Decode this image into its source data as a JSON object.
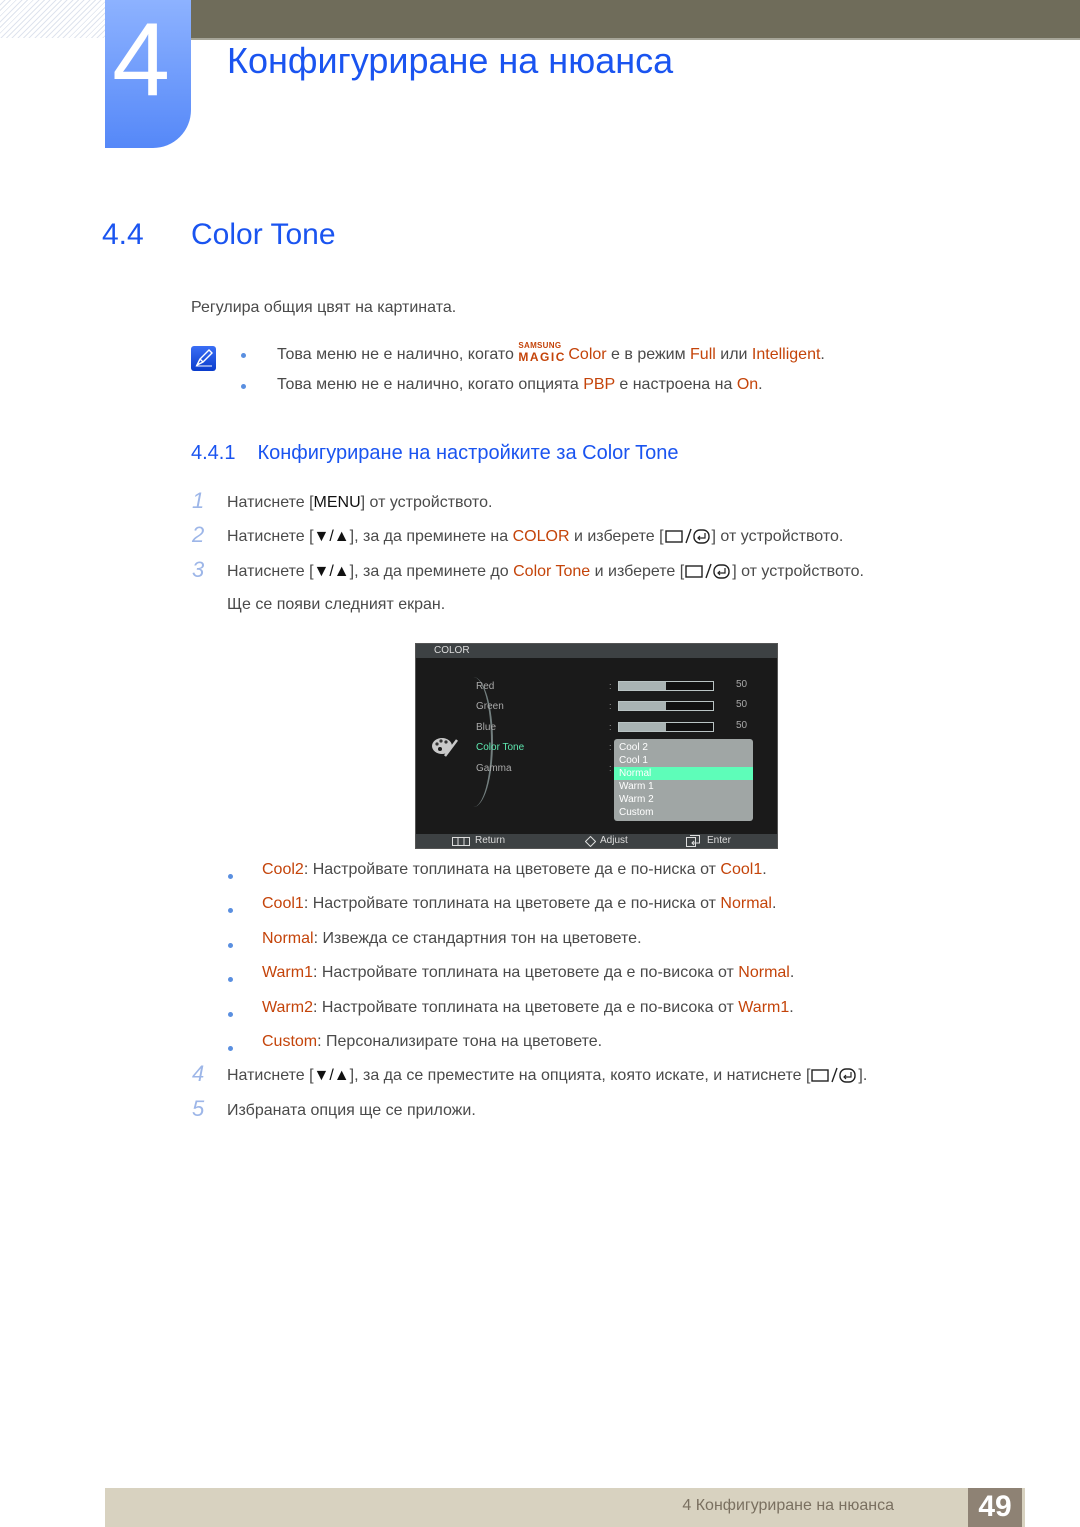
{
  "chapter": {
    "number": "4",
    "title": "Конфигуриране на нюанса"
  },
  "section": {
    "number": "4.4",
    "title": "Color Tone"
  },
  "intro": "Регулира общия цвят на картината.",
  "notes": [
    {
      "pre": "Това меню не е налично, когато ",
      "brand_top": "SAMSUNG",
      "brand_bottom": "MAGIC",
      "brand_word": "Color",
      "mid": " е в режим ",
      "hl1": "Full",
      "mid2": " или ",
      "hl2": "Intelligent",
      "post": "."
    },
    {
      "pre": "Това меню не е налично, когато опцията ",
      "hl1": "PBP",
      "mid": " е настроена на ",
      "hl2": "On",
      "post": "."
    }
  ],
  "subsection": {
    "number": "4.4.1",
    "title": "Конфигуриране на настройките за Color Tone"
  },
  "steps": [
    {
      "num": "1",
      "pre": "Натиснете [",
      "key": "MENU",
      "post": "] от устройството."
    },
    {
      "num": "2",
      "pre": "Натиснете [",
      "key": "▼/▲",
      "mid": "], за да преминете на ",
      "hl": "COLOR",
      "mid2": " и изберете [",
      "post": "] от устройството."
    },
    {
      "num": "3",
      "pre": "Натиснете [",
      "key": "▼/▲",
      "mid": "], за да преминете до ",
      "hl": "Color Tone",
      "mid2": " и изберете [",
      "post": "] от устройството.",
      "extra": "Ще се появи следният екран."
    },
    {
      "num": "4",
      "pre": "Натиснете [",
      "key": "▼/▲",
      "mid": "], за да се преместите на опцията, която искате, и натиснете [",
      "post": "]."
    },
    {
      "num": "5",
      "text": "Избраната опция ще се приложи."
    }
  ],
  "osd": {
    "title": "COLOR",
    "items": [
      {
        "label": "Red",
        "value": "50",
        "level": 0.5
      },
      {
        "label": "Green",
        "value": "50",
        "level": 0.5
      },
      {
        "label": "Blue",
        "value": "50",
        "level": 0.5
      },
      {
        "label": "Color Tone",
        "active": true
      },
      {
        "label": "Gamma"
      }
    ],
    "options": [
      "Cool 2",
      "Cool 1",
      "Normal",
      "Warm 1",
      "Warm 2",
      "Custom"
    ],
    "selected": "Normal",
    "footer": {
      "return": "Return",
      "adjust": "Adjust",
      "enter": "Enter"
    }
  },
  "options_desc": [
    {
      "name": "Cool2",
      "text": ": Настройвате топлината на цветовете да е по-ниска от ",
      "ref": "Cool1",
      "end": "."
    },
    {
      "name": "Cool1",
      "text": ": Настройвате топлината на цветовете да е по-ниска от ",
      "ref": "Normal",
      "end": "."
    },
    {
      "name": "Normal",
      "text": ": Извежда се стандартния тон на цветовете.",
      "ref": "",
      "end": ""
    },
    {
      "name": "Warm1",
      "text": ": Настройвате топлината на цветовете да е по-висока от ",
      "ref": "Normal",
      "end": "."
    },
    {
      "name": "Warm2",
      "text": ": Настройвате топлината на цветовете да е по-висока от ",
      "ref": "Warm1",
      "end": "."
    },
    {
      "name": "Custom",
      "text": ": Персонализирате тона на цветовете.",
      "ref": "",
      "end": ""
    }
  ],
  "footer": {
    "text": "4 Конфигуриране на нюанса",
    "page": "49"
  },
  "colors": {
    "heading_blue": "#1a54f0",
    "highlight": "#c4440a",
    "selected_option": "#5efdb9"
  }
}
